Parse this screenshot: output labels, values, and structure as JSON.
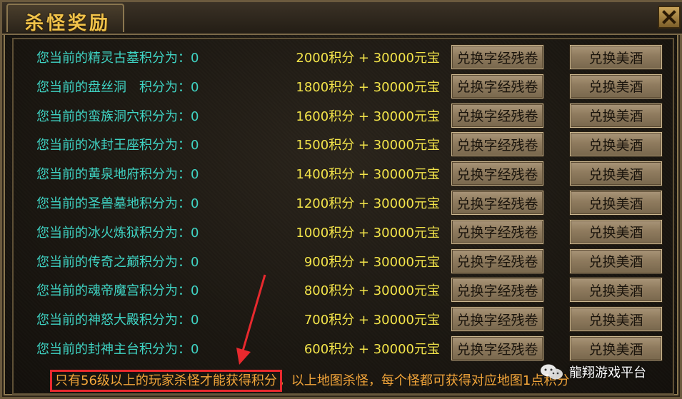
{
  "window": {
    "title": "杀怪奖励",
    "close_label": "X"
  },
  "rows": [
    {
      "label": "您当前的精灵古墓积分为：0",
      "cost": "2000积分 + 30000元宝",
      "btn1": "兑换字经残卷",
      "btn2": "兑换美酒"
    },
    {
      "label": "您当前的盘丝洞　积分为：0",
      "cost": "1800积分 + 30000元宝",
      "btn1": "兑换字经残卷",
      "btn2": "兑换美酒"
    },
    {
      "label": "您当前的蛮族洞穴积分为：0",
      "cost": "1600积分 + 30000元宝",
      "btn1": "兑换字经残卷",
      "btn2": "兑换美酒"
    },
    {
      "label": "您当前的冰封王座积分为：0",
      "cost": "1500积分 + 30000元宝",
      "btn1": "兑换字经残卷",
      "btn2": "兑换美酒"
    },
    {
      "label": "您当前的黄泉地府积分为：0",
      "cost": "1400积分 + 30000元宝",
      "btn1": "兑换字经残卷",
      "btn2": "兑换美酒"
    },
    {
      "label": "您当前的圣兽墓地积分为：0",
      "cost": "1200积分 + 30000元宝",
      "btn1": "兑换字经残卷",
      "btn2": "兑换美酒"
    },
    {
      "label": "您当前的冰火炼狱积分为：0",
      "cost": "1000积分 + 30000元宝",
      "btn1": "兑换字经残卷",
      "btn2": "兑换美酒"
    },
    {
      "label": "您当前的传奇之巅积分为：0",
      "cost": "900积分 + 30000元宝",
      "btn1": "兑换字经残卷",
      "btn2": "兑换美酒"
    },
    {
      "label": "您当前的魂帝魔宫积分为：0",
      "cost": "800积分 + 30000元宝",
      "btn1": "兑换字经残卷",
      "btn2": "兑换美酒"
    },
    {
      "label": "您当前的神怒大殿积分为：0",
      "cost": "700积分 + 30000元宝",
      "btn1": "兑换字经残卷",
      "btn2": "兑换美酒"
    },
    {
      "label": "您当前的封神主台积分为：0",
      "cost": "600积分 + 30000元宝",
      "btn1": "兑换字经残卷",
      "btn2": "兑换美酒"
    }
  ],
  "footer": {
    "highlight": "只有56级以上的玩家杀怪才能获得积分",
    "rest": "，以上地图杀怪，每个怪都可获得对应地图1点积分"
  },
  "watermark": {
    "text": "龍翔游戏平台",
    "icon": "wechat-icon"
  },
  "colors": {
    "label": "#3fd4c4",
    "cost": "#f3e44a",
    "footer": "#f2a53a",
    "annotation": "#e8292e",
    "title": "#f0c24a"
  }
}
